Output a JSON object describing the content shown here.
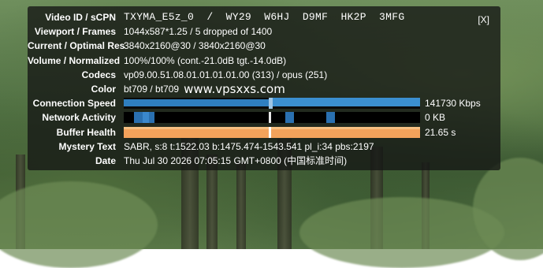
{
  "overlay": {
    "close_label": "[X]",
    "rows": {
      "video_id": {
        "label": "Video ID / sCPN",
        "value": "TXYMA_E5z_0  /  WY29  W6HJ  D9MF  HK2P  3MFG"
      },
      "viewport": {
        "label": "Viewport / Frames",
        "value": "1044x587*1.25 / 5 dropped of 1400"
      },
      "resolution": {
        "label": "Current / Optimal Res",
        "value": "3840x2160@30 / 3840x2160@30"
      },
      "volume": {
        "label": "Volume / Normalized",
        "value": "100%/100% (cont.-21.0dB tgt.-14.0dB)"
      },
      "codecs": {
        "label": "Codecs",
        "value": "vp09.00.51.08.01.01.01.01.00 (313) / opus (251)"
      },
      "color": {
        "label": "Color",
        "value": "bt709 / bt709",
        "extra": "www.vpsxxs.com"
      },
      "connection_speed": {
        "label": "Connection Speed",
        "value": "141730 Kbps"
      },
      "network_activity": {
        "label": "Network Activity",
        "value": "0 KB"
      },
      "buffer_health": {
        "label": "Buffer Health",
        "value": "21.65 s"
      },
      "mystery_text": {
        "label": "Mystery Text",
        "value": "SABR, s:8 t:1522.03 b:1475.474-1543.541 pl_i:34 pbs:2197"
      },
      "date": {
        "label": "Date",
        "value": "Thu Jul 30 2026 07:05:15 GMT+0800 (中国标准时间)"
      }
    }
  },
  "colors": {
    "overlay_bg": "#141614",
    "speed_bar": "#2f7fc0",
    "network_bar": "#2a70b0",
    "buffer_bar": "#f3a25b"
  }
}
